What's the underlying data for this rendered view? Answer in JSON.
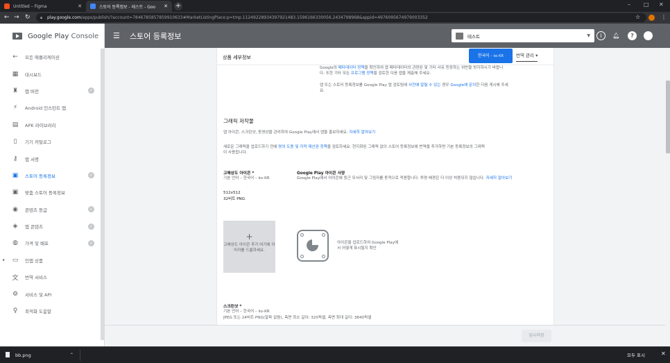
{
  "browser": {
    "tabs": [
      {
        "title": "Untitled – Figma",
        "favicon_color": "#f24e1e"
      },
      {
        "title": "스토어 등록정보 - 테스트 - Goo",
        "favicon_color": "#4285f4"
      }
    ],
    "new_tab": "+",
    "url_host": "play.google.com",
    "url_path": "/apps/publish/?account=7846785857859910633#MarketListingPlace:p=tmp.11249228934397921483.1596166330056.2434798968&appid=4976095674979003352",
    "download_file": "bb.png",
    "show_all": "모두 표시"
  },
  "sidebar": {
    "brand": "Google Play",
    "brand_suffix": "Console",
    "items": [
      {
        "label": "모든 애플리케이션",
        "icon": "arrow-left-icon",
        "glyph": "←",
        "checked": false,
        "active": false
      },
      {
        "label": "대시보드",
        "icon": "dashboard-icon",
        "glyph": "▦",
        "checked": false,
        "active": false
      },
      {
        "label": "앱 버전",
        "icon": "rocket-icon",
        "glyph": "♜",
        "checked": true,
        "active": false
      },
      {
        "label": "Android 인스턴트 앱",
        "icon": "instant-app-icon",
        "glyph": "⚡",
        "checked": false,
        "active": false
      },
      {
        "label": "APK 라이브러리",
        "icon": "library-icon",
        "glyph": "▤",
        "checked": false,
        "active": false
      },
      {
        "label": "기기 카탈로그",
        "icon": "device-icon",
        "glyph": "▯",
        "checked": false,
        "active": false
      },
      {
        "label": "앱 서명",
        "icon": "key-icon",
        "glyph": "⚷",
        "checked": false,
        "active": false
      },
      {
        "label": "스토어 등록정보",
        "icon": "store-icon",
        "glyph": "▣",
        "checked": true,
        "active": true
      },
      {
        "label": "맞춤 스토어 등록정보",
        "icon": "custom-store-icon",
        "glyph": "▣",
        "checked": false,
        "active": false
      },
      {
        "label": "콘텐츠 등급",
        "icon": "rating-icon",
        "glyph": "◉",
        "checked": true,
        "active": false
      },
      {
        "label": "앱 콘텐츠",
        "icon": "shield-icon",
        "glyph": "◈",
        "checked": true,
        "active": false
      },
      {
        "label": "가격 및 배포",
        "icon": "globe-icon",
        "glyph": "◍",
        "checked": true,
        "active": false
      },
      {
        "label": "인앱 상품",
        "icon": "credit-card-icon",
        "glyph": "▭",
        "checked": false,
        "active": false,
        "expandable": true
      },
      {
        "label": "번역 서비스",
        "icon": "translate-icon",
        "glyph": "文",
        "checked": false,
        "active": false
      },
      {
        "label": "서비스 및 API",
        "icon": "api-icon",
        "glyph": "⚙",
        "checked": false,
        "active": false
      },
      {
        "label": "최적화 도움말",
        "icon": "lightbulb-icon",
        "glyph": "♀",
        "checked": false,
        "active": false
      }
    ]
  },
  "header": {
    "title": "스토어 등록정보",
    "app_selector": "테스트"
  },
  "card": {
    "title": "상품 세부정보",
    "lang_button": "한국어",
    "lang_code": "– ko-KR",
    "translate_button": "번역 관리",
    "policy_line1_pre": "Google의 ",
    "policy_line1_link": "메타데이터 정책",
    "policy_line1_post": "을 확인하여 앱 메타데이터의 관련된 및 기타 사유 등장하는 위반을 방지하시기 바랍니",
    "policy_line2_pre": "다. 또한 기타 모든 ",
    "policy_line2_link": "프로그램 정책",
    "policy_line2_post": "을 검토한 다음 앱을 제출해 주세요.",
    "notice_pre": "앱 또는 스토어 등록정보를 Google Play 앱 검토팀에 ",
    "notice_link1": "사전에 알릴 수 있는",
    "notice_mid": " 경우 ",
    "notice_link2": "Google에 문의",
    "notice_post": "한 다음 게시해 주세",
    "notice_end": "요.",
    "graphics_title": "그래픽 저작물",
    "graphics_desc_pre": "앱 아이콘, 스크린샷, 동영상을 관리하여 Google Play에서 앱을 홍보하세요. ",
    "graphics_desc_link": "자세히 알아보기",
    "upload_note_pre": "새로운 그래픽을 업로드하기 전에 ",
    "upload_note_link": "명의 도용 및 지적 재산권 정책",
    "upload_note_post": "을 검토하세요. 현지화된 그래픽 없이 스토어 등록정보에 번역을 추가하면 기본 등록정보의 그래픽",
    "upload_note_end": "이 사용됩니다.",
    "hires_label": "고해상도 아이콘 *",
    "hires_sub": "기본 언어 – 한국어 – ko-KR",
    "hires_size": "512x512",
    "hires_format": "32비트 PNG",
    "spec_title": "Google Play 아이콘 사양",
    "spec_desc": "Google Play에서 아이콘에 둥근 모서리 및 그림자를 동적으로 적용합니다. 투명 배경은 더 이상 허용되지 않습니다.",
    "spec_link": "자세히 알아보기",
    "upload_box_plus": "+",
    "upload_box_text": "고해상도 아이콘 추가 여기에 이미지를 드롭하세요.",
    "preview_text": "아이콘을 업로드하여 Google Play에서 어떻게 표시될지 확인",
    "screens_label": "스크린샷 *",
    "screens_sub": "기본 언어 – 한국어 – ko-KR",
    "screens_format": "JPEG 또는 24비트 PNG(알파 없음), 측면 최소 길이: 320픽셀, 측면 최대 길이: 3840픽셀"
  },
  "footer": {
    "draft_button": "임시저장"
  },
  "colors": {
    "accent": "#1a73e8",
    "appbar": "#5f6368",
    "check": "#c6c9cc"
  }
}
